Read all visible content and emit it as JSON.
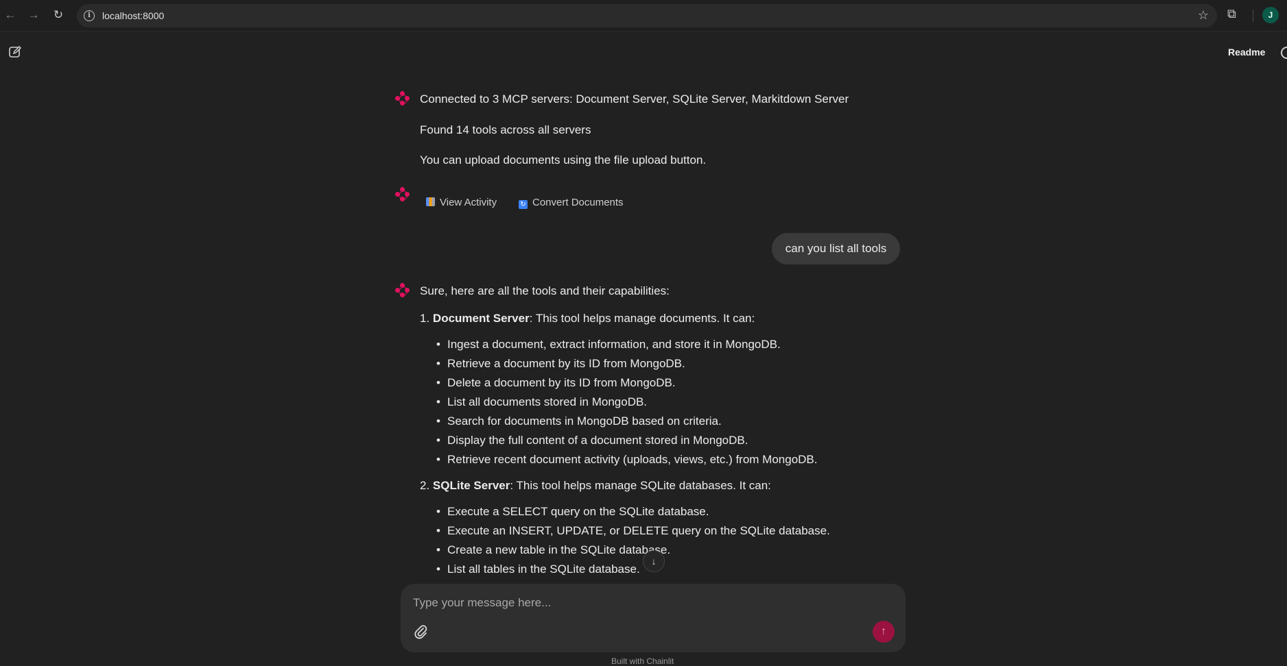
{
  "browser": {
    "url": "localhost:8000",
    "profile_initial": "J"
  },
  "header": {
    "readme_label": "Readme"
  },
  "messages": {
    "welcome": {
      "line1": "Connected to 3 MCP servers: Document Server, SQLite Server, Markitdown Server",
      "line2": "Found 14 tools across all servers",
      "line3": "You can upload documents using the file upload button."
    },
    "actions": [
      {
        "label": "View Activity",
        "icon": "bar-chart-icon"
      },
      {
        "label": "Convert Documents",
        "icon": "convert-icon"
      }
    ],
    "user": {
      "text": "can you list all tools"
    },
    "reply": {
      "intro": "Sure, here are all the tools and their capabilities:",
      "sections": [
        {
          "number": "1.",
          "title": "Document Server",
          "description": ": This tool helps manage documents. It can:",
          "items": [
            "Ingest a document, extract information, and store it in MongoDB.",
            "Retrieve a document by its ID from MongoDB.",
            "Delete a document by its ID from MongoDB.",
            "List all documents stored in MongoDB.",
            "Search for documents in MongoDB based on criteria.",
            "Display the full content of a document stored in MongoDB.",
            "Retrieve recent document activity (uploads, views, etc.) from MongoDB."
          ]
        },
        {
          "number": "2.",
          "title": "SQLite Server",
          "description": ": This tool helps manage SQLite databases. It can:",
          "items": [
            "Execute a SELECT query on the SQLite database.",
            "Execute an INSERT, UPDATE, or DELETE query on the SQLite database.",
            "Create a new table in the SQLite database.",
            "List all tables in the SQLite database."
          ]
        }
      ]
    }
  },
  "composer": {
    "placeholder": "Type your message here..."
  },
  "footer": {
    "built_with": "Built with Chainlit"
  },
  "colors": {
    "accent": "#e0115f",
    "send_button": "#9b1240",
    "background": "#212121"
  }
}
